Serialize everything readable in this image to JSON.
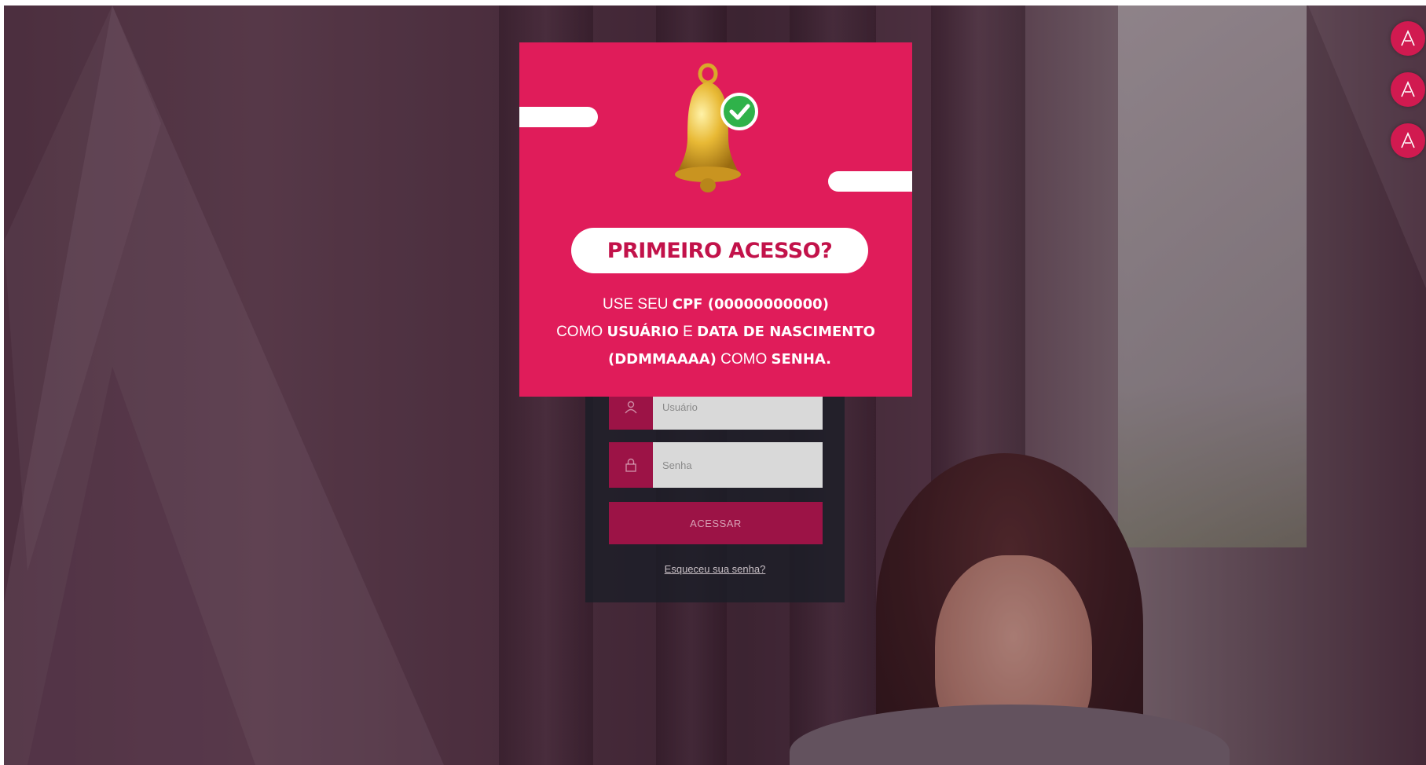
{
  "modal": {
    "title": "PRIMEIRO ACESSO?",
    "line1_prefix": "USE SEU ",
    "line1_bold": "CPF (00000000000)",
    "line2_prefix": "COMO ",
    "line2_bold1": "USUÁRIO",
    "line2_mid": " E ",
    "line2_bold2": "DATA DE NASCIMENTO",
    "line3_bold1": "(DDMMAAAA)",
    "line3_mid": " COMO ",
    "line3_bold2": "SENHA.",
    "icon": "bell-check-icon"
  },
  "login": {
    "username_placeholder": "Usuário",
    "password_placeholder": "Senha",
    "user_icon": "user-icon",
    "lock_icon": "lock-icon",
    "submit_label": "ACESSAR",
    "forgot_label": "Esqueceu sua senha?"
  },
  "side_icons": [
    "logo-a-icon",
    "logo-a-icon",
    "logo-a-icon"
  ],
  "colors": {
    "brand": "#e01c5a",
    "brand_dark": "#9c1346",
    "card": "#1a1e26"
  }
}
